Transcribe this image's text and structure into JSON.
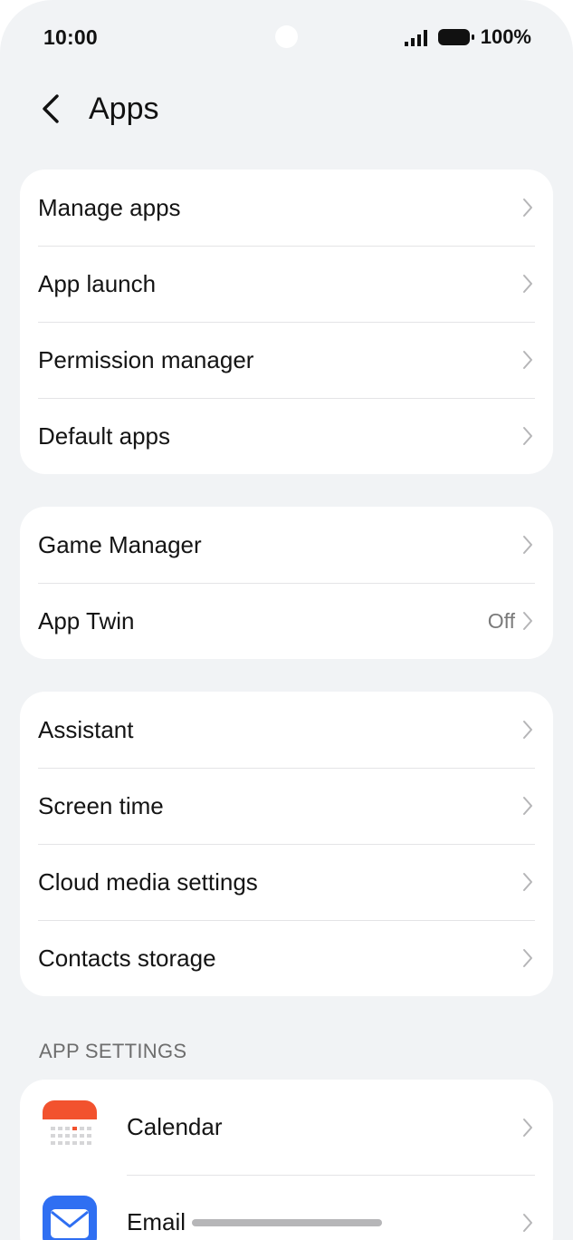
{
  "status_bar": {
    "time": "10:00",
    "battery_text": "100%"
  },
  "header": {
    "title": "Apps"
  },
  "group1": {
    "items": [
      {
        "label": "Manage apps"
      },
      {
        "label": "App launch"
      },
      {
        "label": "Permission manager"
      },
      {
        "label": "Default apps"
      }
    ]
  },
  "group2": {
    "items": [
      {
        "label": "Game Manager",
        "value": ""
      },
      {
        "label": "App Twin",
        "value": "Off"
      }
    ]
  },
  "group3": {
    "items": [
      {
        "label": "Assistant"
      },
      {
        "label": "Screen time"
      },
      {
        "label": "Cloud media settings"
      },
      {
        "label": "Contacts storage"
      }
    ]
  },
  "app_settings": {
    "section_title": "APP SETTINGS",
    "items": [
      {
        "label": "Calendar",
        "icon": "calendar-icon"
      },
      {
        "label": "Email",
        "icon": "email-icon"
      }
    ]
  },
  "colors": {
    "background": "#f1f3f5",
    "card": "#ffffff",
    "calendar_red": "#f2522e",
    "email_blue": "#2f6ff2"
  }
}
